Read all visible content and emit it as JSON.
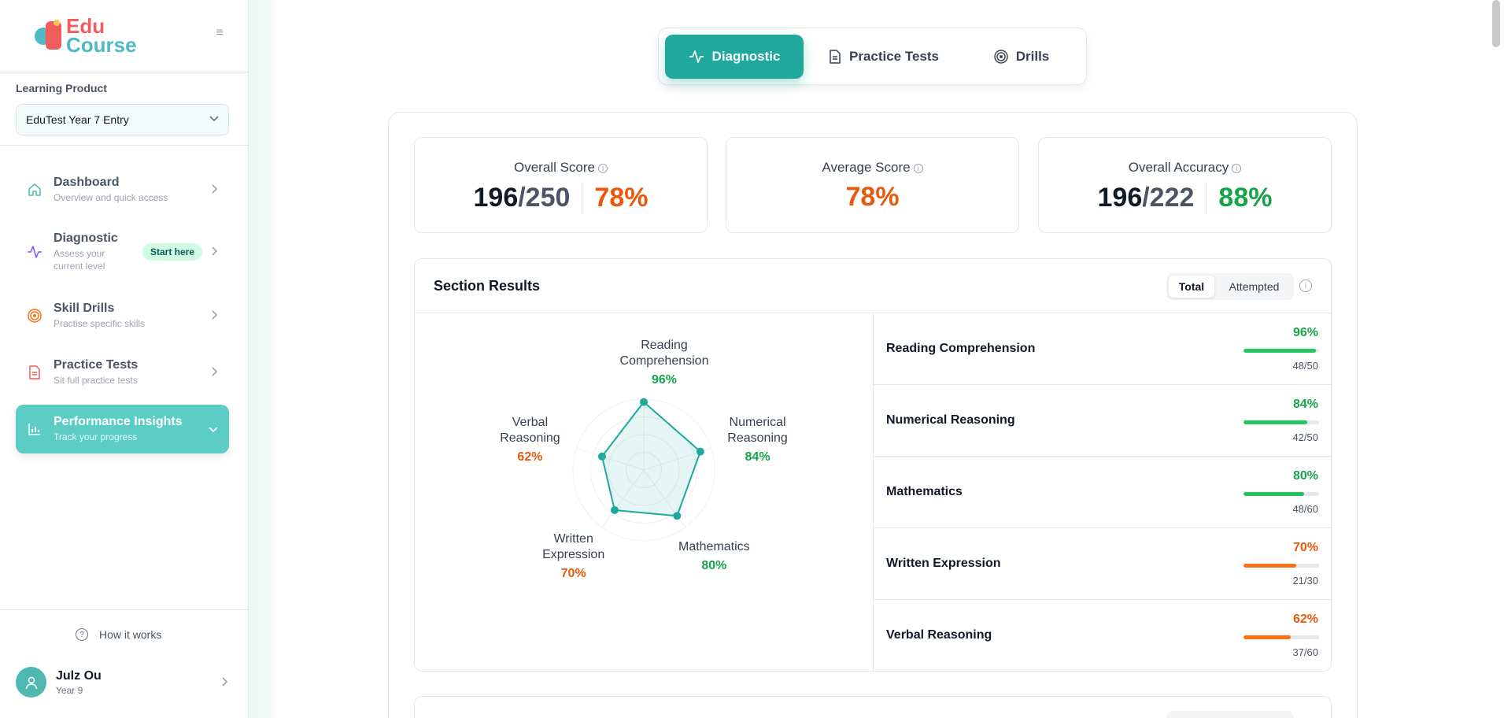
{
  "brand": {
    "line1": "Edu",
    "line2": "Course"
  },
  "sidebar": {
    "learning_product_label": "Learning Product",
    "learning_product_value": "EduTest Year 7 Entry",
    "items": [
      {
        "title": "Dashboard",
        "subtitle": "Overview and quick access",
        "icon": "home-icon"
      },
      {
        "title": "Diagnostic",
        "subtitle": "Assess your current level",
        "badge": "Start here",
        "icon": "pulse-icon"
      },
      {
        "title": "Skill Drills",
        "subtitle": "Practise specific skills",
        "icon": "target-icon"
      },
      {
        "title": "Practice Tests",
        "subtitle": "Sit full practice tests",
        "icon": "document-icon"
      },
      {
        "title": "Performance Insights",
        "subtitle": "Track your progress",
        "icon": "bar-chart-icon",
        "active": true
      }
    ],
    "how_it_works": "How it works",
    "user": {
      "name": "Julz Ou",
      "grade": "Year 9"
    }
  },
  "mode_tabs": [
    {
      "label": "Diagnostic",
      "active": true
    },
    {
      "label": "Practice Tests"
    },
    {
      "label": "Drills"
    }
  ],
  "stats": {
    "overall_score": {
      "label": "Overall Score",
      "num": "196",
      "den": "/250",
      "pct": "78%"
    },
    "average_score": {
      "label": "Average Score",
      "pct": "78%"
    },
    "overall_accuracy": {
      "label": "Overall Accuracy",
      "num": "196",
      "den": "/222",
      "pct": "88%"
    }
  },
  "section_results": {
    "title": "Section Results",
    "toggle": {
      "total": "Total",
      "attempted": "Attempted",
      "active": "Total"
    },
    "rows": [
      {
        "label": "Reading Comprehension",
        "pct": "96%",
        "frac": "48/50",
        "value": 0.96,
        "status": "green"
      },
      {
        "label": "Numerical Reasoning",
        "pct": "84%",
        "frac": "42/50",
        "value": 0.84,
        "status": "green"
      },
      {
        "label": "Mathematics",
        "pct": "80%",
        "frac": "48/60",
        "value": 0.8,
        "status": "green"
      },
      {
        "label": "Written Expression",
        "pct": "70%",
        "frac": "21/30",
        "value": 0.7,
        "status": "orange"
      },
      {
        "label": "Verbal Reasoning",
        "pct": "62%",
        "frac": "37/60",
        "value": 0.62,
        "status": "orange"
      }
    ]
  },
  "colors": {
    "accent": "#1fa99c",
    "green": "#16a34a",
    "orange": "#ea580c",
    "bar_green": "#22c55e",
    "bar_orange": "#f97316"
  },
  "chart_data": {
    "type": "radar",
    "axes": [
      {
        "label": [
          "Reading",
          "Comprehension"
        ],
        "value": 96,
        "value_label": "96%"
      },
      {
        "label": [
          "Numerical",
          "Reasoning"
        ],
        "value": 84,
        "value_label": "84%"
      },
      {
        "label": [
          "Mathematics"
        ],
        "value": 80,
        "value_label": "80%"
      },
      {
        "label": [
          "Written",
          "Expression"
        ],
        "value": 70,
        "value_label": "70%"
      },
      {
        "label": [
          "Verbal",
          "Reasoning"
        ],
        "value": 62,
        "value_label": "62%"
      }
    ],
    "range": [
      0,
      100
    ]
  }
}
